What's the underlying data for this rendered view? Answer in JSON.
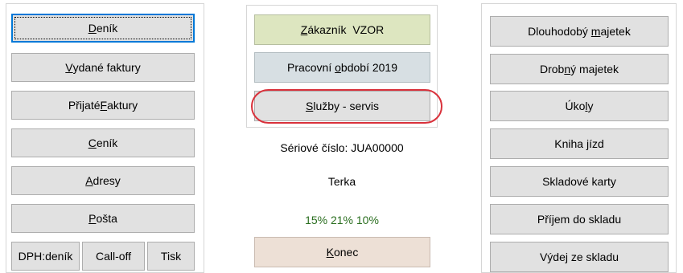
{
  "left": {
    "buttons": [
      {
        "pre": "",
        "u": "D",
        "post": "eník"
      },
      {
        "pre": "",
        "u": "V",
        "post": "ydané faktury"
      },
      {
        "pre": "Přijaté ",
        "u": "F",
        "post": "aktury"
      },
      {
        "pre": "",
        "u": "C",
        "post": "eník"
      },
      {
        "pre": "",
        "u": "A",
        "post": "dresy"
      },
      {
        "pre": "",
        "u": "P",
        "post": "ošta"
      }
    ],
    "bottom": [
      "DPH:deník",
      "Call-off",
      "Tisk"
    ]
  },
  "center": {
    "customer": {
      "pre": "",
      "u": "Z",
      "post": "ákazník  VZOR"
    },
    "period": {
      "pre": "Pracovní ",
      "u": "o",
      "post": "bdobí 2019"
    },
    "services": {
      "pre": "",
      "u": "S",
      "post": "lužby - servis"
    },
    "serial": "Sériové číslo: JUA00000",
    "user": "Terka",
    "vat_rates": "15% 21% 10%",
    "exit": {
      "pre": "",
      "u": "K",
      "post": "onec"
    }
  },
  "right": {
    "buttons": [
      {
        "pre": "Dlouhodobý ",
        "u": "m",
        "post": "ajetek"
      },
      {
        "pre": "Drob",
        "u": "n",
        "post": "ý majetek"
      },
      {
        "pre": "Úko",
        "u": "l",
        "post": "y"
      },
      {
        "pre": "Kniha ",
        "u": "j",
        "post": "ízd"
      },
      {
        "pre": "Skladové karty",
        "u": "",
        "post": ""
      },
      {
        "pre": "Příjem do skladu",
        "u": "",
        "post": ""
      },
      {
        "pre": "Výdej ze skladu",
        "u": "",
        "post": ""
      }
    ]
  },
  "colors": {
    "focus": "#0078d7",
    "highlight_ellipse": "#d9313b",
    "vat_text": "#2a6e1f"
  }
}
